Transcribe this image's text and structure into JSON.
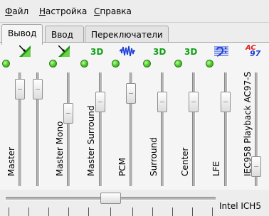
{
  "menu": {
    "file": "Файл",
    "settings": "Настройка",
    "help": "Справка"
  },
  "tabs": [
    "Вывод",
    "Ввод",
    "Переключатели"
  ],
  "channels": [
    {
      "label": "Master",
      "icon": "volume-icon"
    },
    {
      "label": "Master Mono",
      "icon": "volume-icon"
    },
    {
      "label": "Master Surround",
      "icon": "3d-icon"
    },
    {
      "label": "PCM",
      "icon": "waveform-icon"
    },
    {
      "label": "Surround",
      "icon": "3d-icon"
    },
    {
      "label": "Center",
      "icon": "3d-icon"
    },
    {
      "label": "LFE",
      "icon": "bass-clef-icon"
    },
    {
      "label": "IEC958 Playback AC97-S",
      "icon": "ac97-icon"
    }
  ],
  "icon_text": {
    "three_d": "3D",
    "ac": "AC",
    "ninety_seven": "97"
  },
  "card_name": "Intel ICH5"
}
